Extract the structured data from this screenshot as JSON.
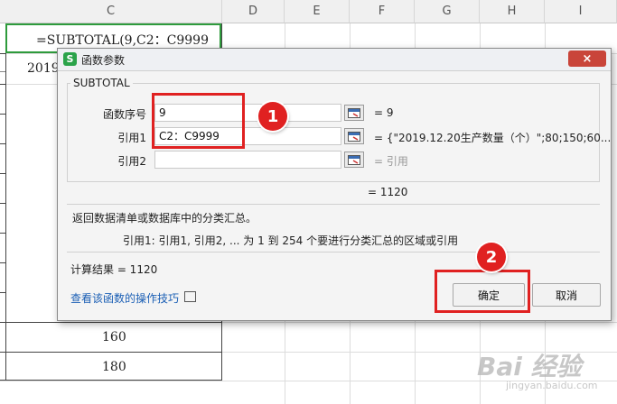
{
  "sheet": {
    "columns": [
      "C",
      "D",
      "E",
      "F",
      "G",
      "H",
      "I"
    ],
    "formula_cell": "=SUBTOTAL(9,C2：C9999",
    "partial_cell": "2019",
    "values": [
      "160",
      "180"
    ]
  },
  "dialog": {
    "title": "函数参数",
    "close_glyph": "×",
    "function_name": "SUBTOTAL",
    "args": [
      {
        "label": "函数序号",
        "value": "9",
        "result": "= 9"
      },
      {
        "label": "引用1",
        "value": "C2：C9999",
        "result": "= {\"2019.12.20生产数量（个）\";80;150;60..."
      },
      {
        "label": "引用2",
        "value": "",
        "result": "= 引用"
      }
    ],
    "total_result": "= 1120",
    "description": "返回数据清单或数据库中的分类汇总。",
    "param_help": "引用1:  引用1, 引用2, ... 为 1 到 254 个要进行分类汇总的区域或引用",
    "calc_result": "计算结果 =  1120",
    "help_link": "查看该函数的操作技巧",
    "ok_label": "确定",
    "cancel_label": "取消"
  },
  "annotations": {
    "badge1": "1",
    "badge2": "2",
    "color": "#e02121"
  },
  "watermark": {
    "main": "Bai 经验",
    "sub": "jingyan.baidu.com"
  }
}
